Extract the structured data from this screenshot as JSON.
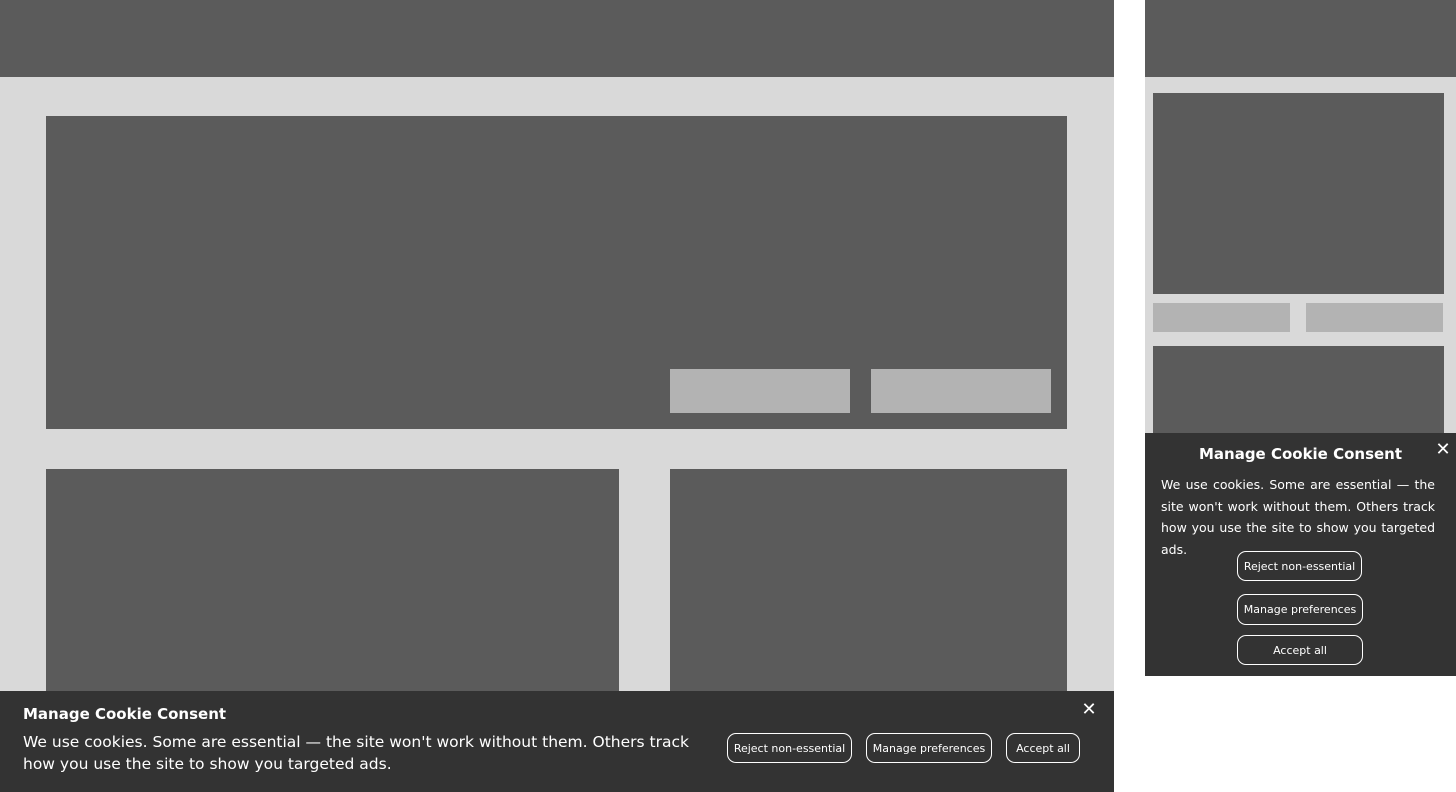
{
  "colors": {
    "header": "#5b5b5b",
    "page_background": "#d9d9d9",
    "placeholder_block": "#5b5b5b",
    "placeholder_button": "#b3b3b3",
    "banner_background": "#333333",
    "banner_text": "#ffffff"
  },
  "desktop_banner": {
    "title": "Manage Cookie Consent",
    "body": "We use cookies. Some are essential — the site won't work without them. Others track how you use the site to show you targeted ads.",
    "buttons": {
      "reject": "Reject non-essential",
      "manage": "Manage preferences",
      "accept": "Accept all"
    },
    "close_icon": "✕"
  },
  "mobile_banner": {
    "title": "Manage Cookie Consent",
    "body": "We use cookies. Some are essential — the site won't work without them. Others track how you use the site to show you targeted ads.",
    "buttons": {
      "reject": "Reject non-essential",
      "manage": "Manage preferences",
      "accept": "Accept all"
    },
    "close_icon": "✕"
  }
}
